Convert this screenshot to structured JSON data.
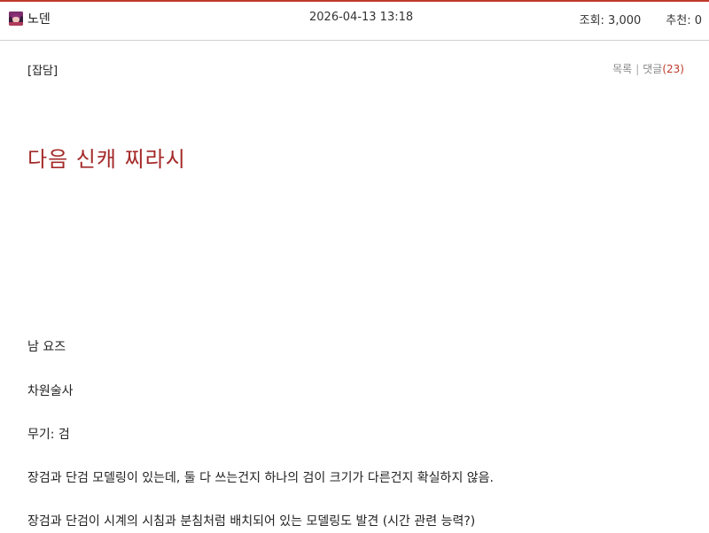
{
  "header": {
    "author": "노덴",
    "avatar_icon": "character-avatar",
    "date": "2026-04-13 13:18",
    "views": "조회: 3,000",
    "recommends": "추천: 0"
  },
  "post": {
    "category": "[잡담]",
    "list_label": "목록",
    "separator": "|",
    "comments_label": "댓글",
    "comments_count": "(23)",
    "title": "다음 신캐 찌라시",
    "lines": [
      "남 요즈",
      "차원술사",
      "무기: 검",
      "장검과 단검 모델링이 있는데, 둘 다 쓰는건지 하나의 검이 크기가 다른건지 확실하지 않음.",
      "장검과 단검이 시계의 시침과 분침처럼 배치되어 있는 모델링도 발견 (시간 관련 능력?)"
    ]
  },
  "colors": {
    "accent": "#c0392b",
    "title": "#a52a2a"
  }
}
